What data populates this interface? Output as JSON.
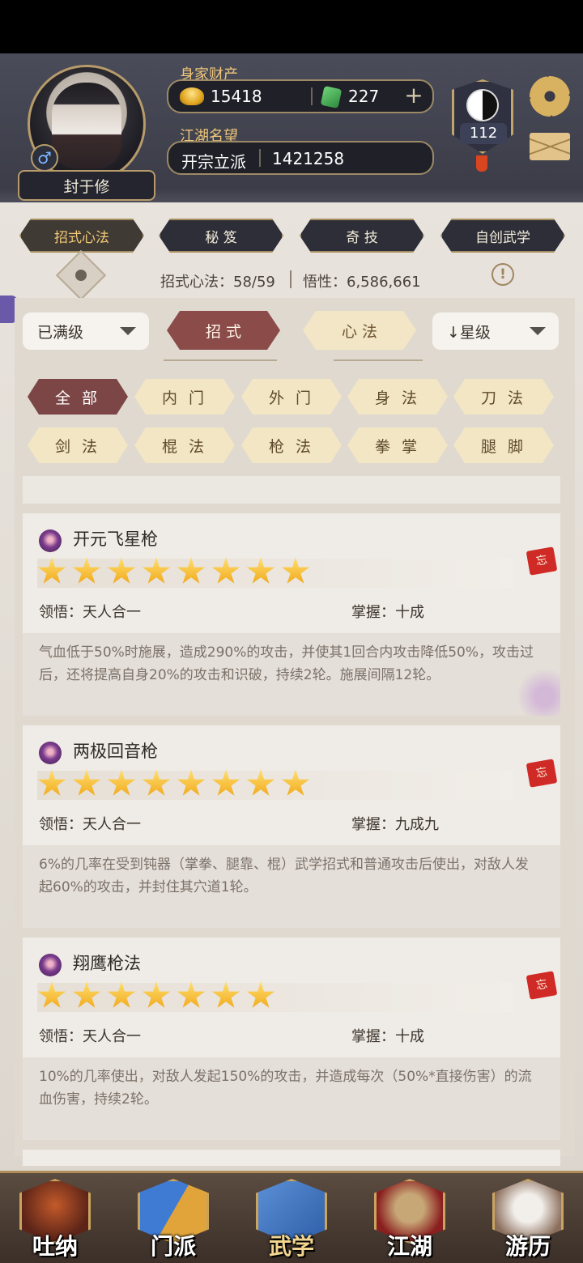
{
  "profile": {
    "gender_symbol": "♂",
    "name": "封于修",
    "wealth_label": "身家财产",
    "gold": "15418",
    "jade": "227",
    "add_symbol": "+",
    "reputation_label": "江湖名望",
    "rank_title": "开宗立派",
    "reputation_value": "1421258",
    "level": "112"
  },
  "top_tabs": [
    {
      "label": "招式心法",
      "active": true
    },
    {
      "label": "秘 笈",
      "active": false
    },
    {
      "label": "奇 技",
      "active": false
    },
    {
      "label": "自创武学",
      "active": false
    }
  ],
  "stats": {
    "skills_label": "招式心法：58/59",
    "insight_label": "悟性：6,586,661",
    "info_symbol": "!"
  },
  "filters": {
    "level_filter": "已满级",
    "mode_tabs": [
      "招 式",
      "心 法"
    ],
    "sort": "↓星级"
  },
  "categories": [
    {
      "label": "全 部",
      "active": true
    },
    {
      "label": "内 门",
      "active": false
    },
    {
      "label": "外 门",
      "active": false
    },
    {
      "label": "身 法",
      "active": false
    },
    {
      "label": "刀 法",
      "active": false
    },
    {
      "label": "剑 法",
      "active": false
    },
    {
      "label": "棍 法",
      "active": false
    },
    {
      "label": "枪 法",
      "active": false
    },
    {
      "label": "拳 掌",
      "active": false
    },
    {
      "label": "腿 脚",
      "active": false
    }
  ],
  "skills": [
    {
      "name": "开元飞星枪",
      "stars": 8,
      "insight": "领悟：天人合一",
      "mastery": "掌握：十成",
      "description": "气血低于50%时施展，造成290%的攻击，并使其1回合内攻击降低50%，攻击过后，还将提高自身20%的攻击和识破，持续2轮。施展间隔12轮。",
      "forget_label": "忘"
    },
    {
      "name": "两极回音枪",
      "stars": 8,
      "insight": "领悟：天人合一",
      "mastery": "掌握：九成九",
      "description": "6%的几率在受到钝器（掌拳、腿靠、棍）武学招式和普通攻击后使出，对敌人发起60%的攻击，并封住其穴道1轮。",
      "forget_label": "忘"
    },
    {
      "name": "翔鹰枪法",
      "stars": 7,
      "insight": "领悟：天人合一",
      "mastery": "掌握：十成",
      "description": "10%的几率使出，对敌人发起150%的攻击，并造成每次（50%*直接伤害）的流血伤害，持续2轮。",
      "forget_label": "忘"
    }
  ],
  "bottom_nav": [
    {
      "label": "吐纳",
      "active": false
    },
    {
      "label": "门派",
      "active": false
    },
    {
      "label": "武学",
      "active": true
    },
    {
      "label": "江湖",
      "active": false
    },
    {
      "label": "游历",
      "active": false
    }
  ],
  "colors": {
    "gold_accent": "#f0c779",
    "active_category": "#7c4646",
    "inactive_category": "#f3e6c4",
    "star": "#f0a516"
  }
}
